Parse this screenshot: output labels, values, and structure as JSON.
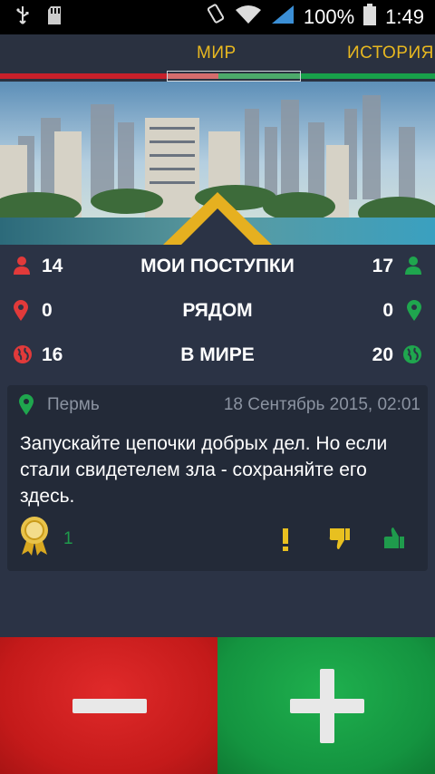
{
  "status_bar": {
    "battery": "100%",
    "time": "1:49",
    "icons": [
      "usb-icon",
      "sdcard-icon",
      "rotate-icon",
      "wifi-icon",
      "signal-icon",
      "battery-icon"
    ]
  },
  "tabs": [
    {
      "label": "МИР",
      "selected": true
    },
    {
      "label": "ИСТОРИЯ",
      "selected": false
    }
  ],
  "stats": {
    "rows": [
      {
        "label": "МОИ ПОСТУПКИ",
        "left": "14",
        "right": "17",
        "left_icon": "person-icon",
        "right_icon": "person-icon"
      },
      {
        "label": "РЯДОМ",
        "left": "0",
        "right": "0",
        "left_icon": "map-pin-icon",
        "right_icon": "map-pin-icon"
      },
      {
        "label": "В МИРЕ",
        "left": "16",
        "right": "20",
        "left_icon": "globe-icon",
        "right_icon": "globe-icon"
      }
    ]
  },
  "post": {
    "city": "Пермь",
    "date": "18 Сентябрь 2015, 02:01",
    "text": "Запускайте цепочки добрых дел. Но если стали свидетелем зла - сохраняйте его здесь.",
    "award_count": "1"
  },
  "buttons": {
    "minus_icon": "minus-icon",
    "plus_icon": "plus-icon"
  },
  "colors": {
    "red": "#c41a1a",
    "green": "#149440",
    "gold": "#e8b820",
    "background": "#2b3345"
  }
}
